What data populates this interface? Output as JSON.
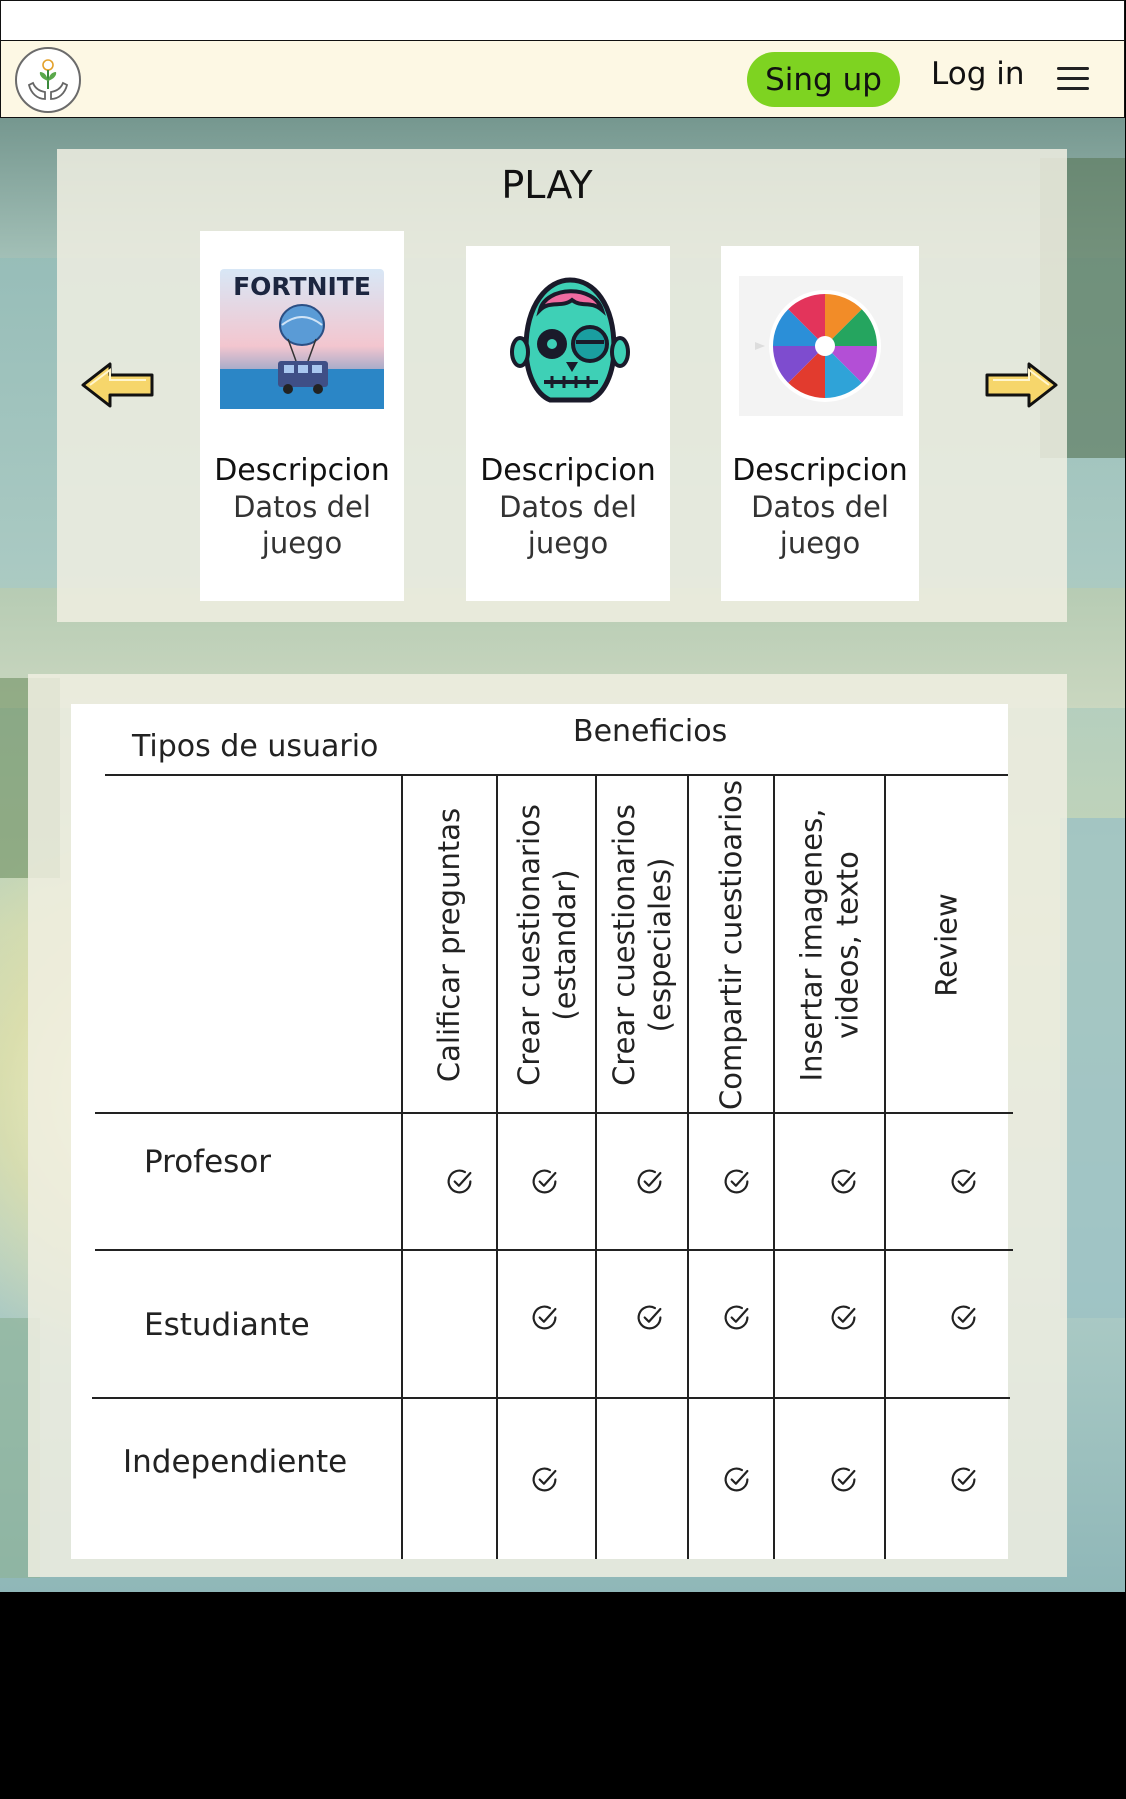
{
  "nav": {
    "logo_icon": "hands-plant-bulb-icon",
    "signup_label": "Sing up",
    "login_label": "Log in",
    "menu_icon": "hamburger-menu-icon"
  },
  "play": {
    "title": "PLAY",
    "cards": [
      {
        "image": "fortnite-battle-bus-image",
        "title": "Descripcion",
        "description": "Datos del juego"
      },
      {
        "image": "zombie-skull-image",
        "title": "Descripcion",
        "description": "Datos del juego"
      },
      {
        "image": "spin-wheel-image",
        "title": "Descripcion",
        "description": "Datos del juego"
      }
    ],
    "prev_icon": "arrow-left-icon",
    "next_icon": "arrow-right-icon",
    "logo_text": "FORTNITE"
  },
  "benefits_table": {
    "row_header": "Tipos de usuario",
    "column_group": "Beneficios",
    "columns": [
      [
        "Calificar preguntas"
      ],
      [
        "Crear cuestionarios",
        "(estandar)"
      ],
      [
        "Crear cuestionarios",
        "(especiales)"
      ],
      [
        "Compartir cuestioarios"
      ],
      [
        "Insertar imagenes,",
        "videos, texto"
      ],
      [
        "Review"
      ]
    ],
    "rows": [
      {
        "label": "Profesor",
        "checks": [
          true,
          true,
          true,
          true,
          true,
          true
        ]
      },
      {
        "label": "Estudiante",
        "checks": [
          false,
          true,
          true,
          true,
          true,
          true
        ]
      },
      {
        "label": "Independiente",
        "checks": [
          false,
          true,
          false,
          true,
          true,
          true
        ]
      }
    ],
    "check_icon": "check-circle-icon"
  },
  "colors": {
    "signup_bg": "#7ed321",
    "navbar_bg": "#fdf8e4",
    "arrow_fill": "#f6d66b"
  }
}
